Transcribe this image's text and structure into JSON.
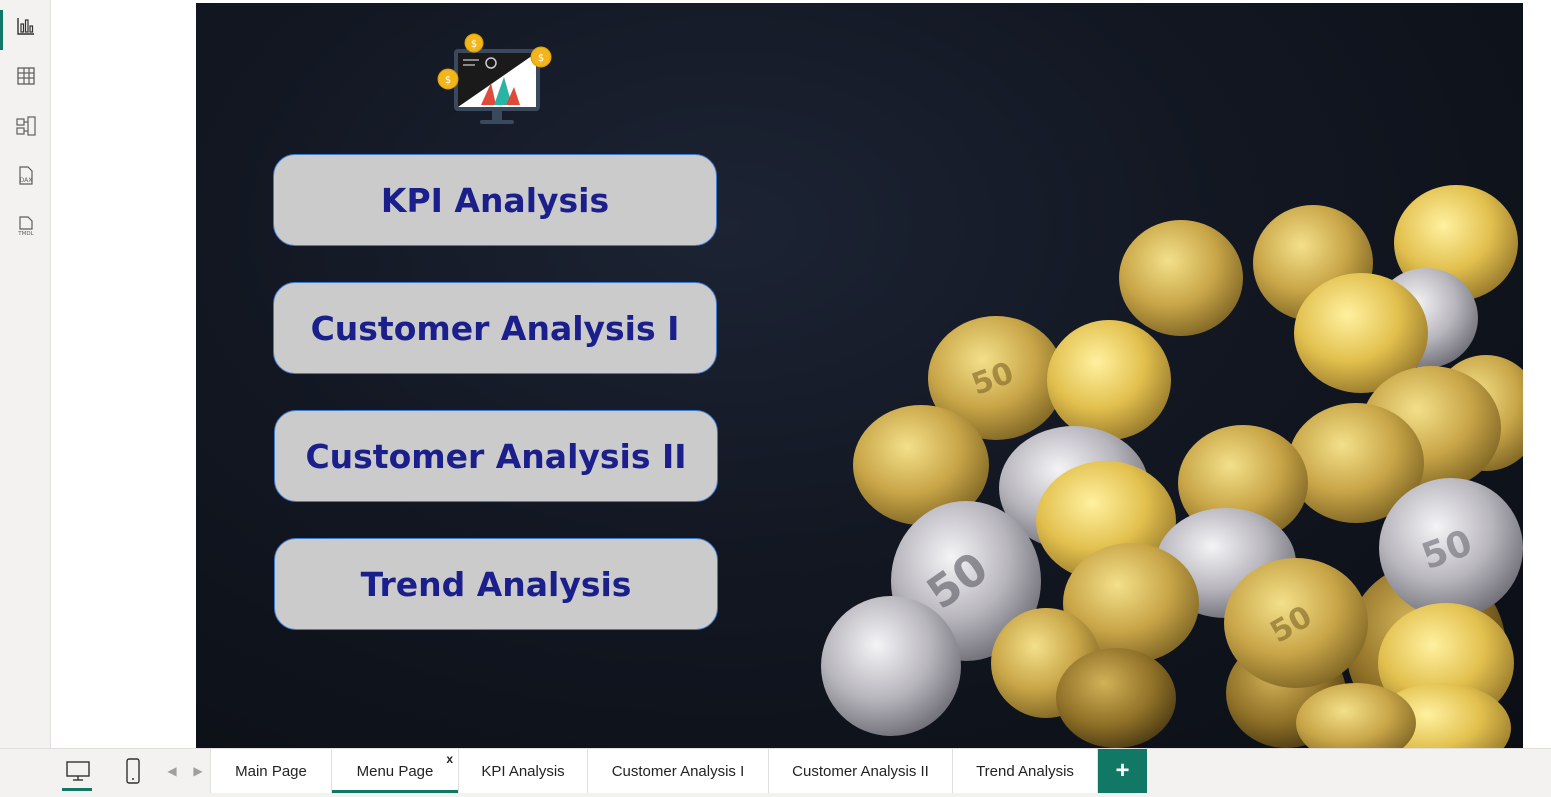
{
  "rail": {
    "items": [
      {
        "name": "report-view-icon",
        "label": ""
      },
      {
        "name": "table-view-icon",
        "label": ""
      },
      {
        "name": "model-view-icon",
        "label": ""
      },
      {
        "name": "dax-query-view-icon",
        "label": "DAX"
      },
      {
        "name": "tmdl-view-icon",
        "label": "TMDL"
      }
    ],
    "active_index": 0
  },
  "report": {
    "buttons": [
      {
        "label": "KPI Analysis"
      },
      {
        "label": "Customer Analysis I"
      },
      {
        "label": "Customer Analysis II"
      },
      {
        "label": "Trend Analysis"
      }
    ]
  },
  "tabs": {
    "items": [
      {
        "label": "Main Page"
      },
      {
        "label": "Menu Page",
        "close": "x"
      },
      {
        "label": "KPI Analysis"
      },
      {
        "label": "Customer Analysis I"
      },
      {
        "label": "Customer Analysis II"
      },
      {
        "label": "Trend Analysis"
      }
    ],
    "active_index": 1,
    "add_label": "+"
  },
  "colors": {
    "accent": "#117865",
    "button_fill": "#cbcbcb",
    "button_text": "#1a1f8c",
    "button_border": "#3d7dd8",
    "page_bg": "#121722"
  }
}
